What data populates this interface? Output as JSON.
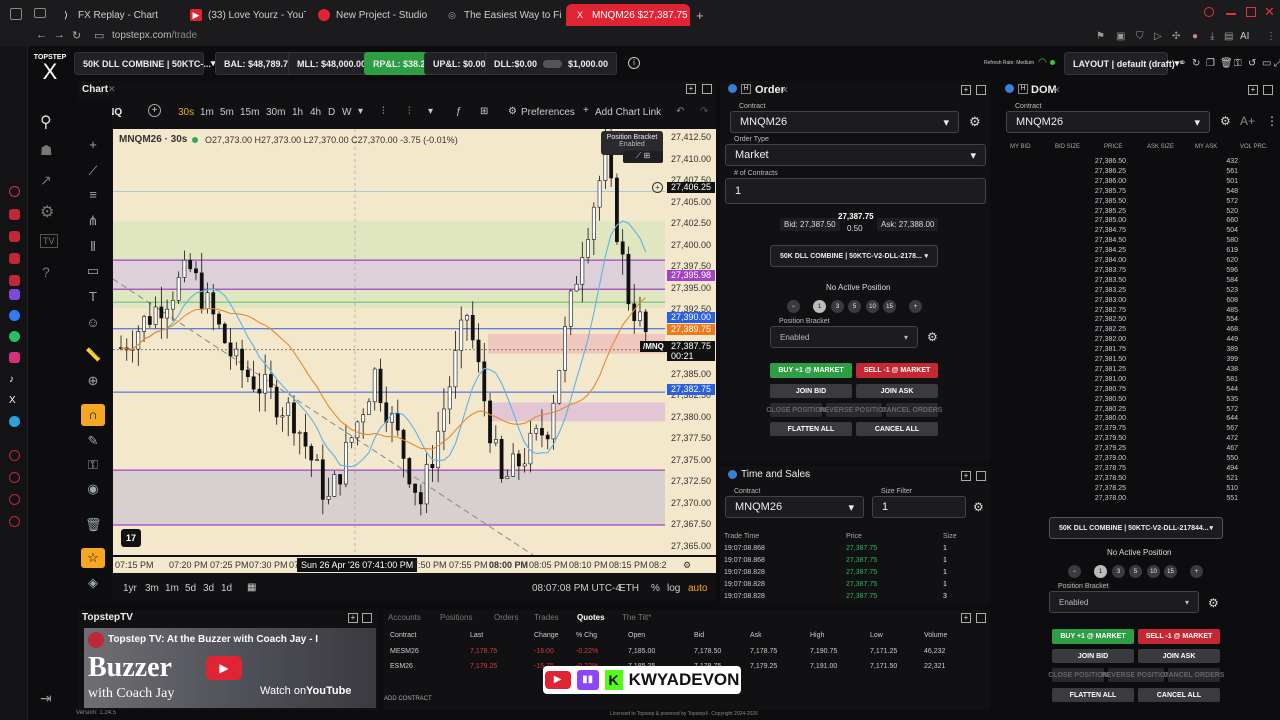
{
  "browser": {
    "tabs": [
      {
        "label": "FX Replay - Chart",
        "active": false
      },
      {
        "label": "(33) Love Yourz - YouTub",
        "active": false
      },
      {
        "label": "New Project - Studio",
        "active": false
      },
      {
        "label": "The Easiest Way to Find F",
        "active": false
      },
      {
        "label": "MNQM26 $27,387.75 ▼ -",
        "active": true
      }
    ],
    "new_tab": "+",
    "url_host": "topstepx.com",
    "url_path": "/trade",
    "toolbar_ai": "AI"
  },
  "app": {
    "logo_top": "TOPSTEP",
    "logo_mark": "X",
    "version": "Version: 1.24.5",
    "footer": "Licensed to Topstep & powered by TopstepX. Copyright 2024-2026",
    "refresh_rate": "Refresh Rate: Medium"
  },
  "topbar": {
    "account": "50K DLL COMBINE  |  50KTC-...",
    "bal": "BAL: $48,789.76",
    "mll": "MLL: $48,000.00",
    "rpl": "RP&L: $38.28",
    "upl": "UP&L: $0.00",
    "dll": "DLL:$0.00",
    "dll_limit": "$1,000.00",
    "layout": "LAYOUT | default (draft)"
  },
  "chart": {
    "panel_title": "Chart",
    "symbol_search": "/MNQ",
    "intervals": [
      "30s",
      "1m",
      "5m",
      "15m",
      "30m",
      "1h",
      "4h",
      "D",
      "W"
    ],
    "active_interval": "30s",
    "preferences": "Preferences",
    "add_chart_link": "Add Chart Link",
    "legend_symbol": "MNQM26 · 30s",
    "legend_ohlc": "O27,373.00  H27,373.00  L27,370.00  C27,370.00  -3.75 (-0.01%)",
    "bracket_tooltip_title": "Position Bracket",
    "bracket_tooltip_value": "Enabled",
    "price_labels": [
      "27,412.50",
      "27,410.00",
      "27,407.50",
      "27,405.00",
      "27,402.50",
      "27,400.00",
      "27,397.50",
      "27,395.00",
      "27,392.50",
      "27,390.00",
      "27,387.50",
      "27,385.00",
      "27,382.50",
      "27,380.00",
      "27,377.50",
      "27,375.00",
      "27,372.50",
      "27,370.00",
      "27,367.50",
      "27,365.00"
    ],
    "marker_labels": {
      "cross": "27,406.25",
      "purple": "27,395.98",
      "blue1": "27,390.00",
      "orange": "27,389.75",
      "current": "27,387.75",
      "countdown": "00:21",
      "blue2": "27,382.75",
      "symbol_tag": "/MNQ"
    },
    "time_labels": [
      "07:15 PM",
      "07:20 PM",
      "07:25 PM",
      "07:30 PM",
      "07:3",
      "7:50 PM",
      "07:55 PM",
      "08:00 PM",
      "08:05 PM",
      "08:10 PM",
      "08:15 PM",
      "08:2"
    ],
    "crosshair_time": "Sun 26 Apr '26   07:41:00 PM",
    "ranges": [
      "1yr",
      "3m",
      "1m",
      "5d",
      "3d",
      "1d"
    ],
    "clock": "08:07:08 PM UTC-4",
    "session": "ETH",
    "pct": "%",
    "log": "log",
    "auto": "auto"
  },
  "order": {
    "title": "Order",
    "contract_label": "Contract",
    "contract": "MNQM26",
    "order_type_label": "Order Type",
    "order_type": "Market",
    "qty_label": "# of Contracts",
    "qty": "1",
    "bid": "Bid: 27,387.50",
    "last": "27,387.75",
    "spread": "0.50",
    "ask": "Ask: 27,388.00",
    "account": "50K DLL COMBINE  |  50KTC-V2-DLL-2178...",
    "position": "No Active Position",
    "quick_qty": [
      "−",
      "1",
      "3",
      "5",
      "10",
      "15",
      "+"
    ],
    "bracket_label": "Position Bracket",
    "bracket": "Enabled",
    "buy": "BUY +1 @ MARKET",
    "sell": "SELL -1 @ MARKET",
    "join_bid": "JOIN BID",
    "join_ask": "JOIN ASK",
    "close_position": "CLOSE POSITION",
    "reverse_position": "REVERSE POSITION",
    "cancel_orders": "CANCEL ORDERS",
    "flatten_all": "FLATTEN ALL",
    "cancel_all": "CANCEL ALL"
  },
  "time_sales": {
    "title": "Time and Sales",
    "contract_label": "Contract",
    "contract": "MNQM26",
    "size_filter_label": "Size Filter",
    "size_filter": "1",
    "headers": [
      "Trade Time",
      "Price",
      "Size"
    ],
    "rows": [
      [
        "19:07:08.868",
        "27,387.75",
        "1"
      ],
      [
        "19:07:08.868",
        "27,387.75",
        "1"
      ],
      [
        "19:07:08.828",
        "27,387.75",
        "1"
      ],
      [
        "19:07:08.828",
        "27,387.75",
        "1"
      ],
      [
        "19:07:08.828",
        "27,387.75",
        "3"
      ]
    ]
  },
  "dom": {
    "title": "DOM",
    "contract_label": "Contract",
    "contract": "MNQM26",
    "headers": [
      "MY BID",
      "BID SIZE",
      "PRICE",
      "ASK SIZE",
      "MY ASK",
      "VOL PRC."
    ],
    "rows": [
      [
        "27,386.50",
        "432"
      ],
      [
        "27,386.25",
        "561"
      ],
      [
        "27,386.00",
        "501"
      ],
      [
        "27,385.75",
        "548"
      ],
      [
        "27,385.50",
        "572"
      ],
      [
        "27,385.25",
        "520"
      ],
      [
        "27,385.00",
        "660"
      ],
      [
        "27,384.75",
        "504"
      ],
      [
        "27,384.50",
        "580"
      ],
      [
        "27,384.25",
        "619"
      ],
      [
        "27,384.00",
        "620"
      ],
      [
        "27,383.75",
        "596"
      ],
      [
        "27,383.50",
        "584"
      ],
      [
        "27,383.25",
        "523"
      ],
      [
        "27,383.00",
        "608"
      ],
      [
        "27,382.75",
        "485"
      ],
      [
        "27,382.50",
        "554"
      ],
      [
        "27,382.25",
        "468"
      ],
      [
        "27,382.00",
        "449"
      ],
      [
        "27,381.75",
        "389"
      ],
      [
        "27,381.50",
        "399"
      ],
      [
        "27,381.25",
        "438"
      ],
      [
        "27,381.00",
        "581"
      ],
      [
        "27,380.75",
        "544"
      ],
      [
        "27,380.50",
        "535"
      ],
      [
        "27,380.25",
        "572"
      ],
      [
        "27,380.00",
        "644"
      ],
      [
        "27,379.75",
        "567"
      ],
      [
        "27,379.50",
        "472"
      ],
      [
        "27,379.25",
        "467"
      ],
      [
        "27,379.00",
        "550"
      ],
      [
        "27,378.75",
        "494"
      ],
      [
        "27,378.50",
        "521"
      ],
      [
        "27,378.25",
        "510"
      ],
      [
        "27,378.00",
        "551"
      ]
    ],
    "account": "50K DLL COMBINE  |  50KTC-V2-DLL-217844...",
    "position": "No Active Position",
    "bracket_label": "Position Bracket",
    "bracket": "Enabled",
    "buy": "BUY +1 @ MARKET",
    "sell": "SELL -1 @ MARKET",
    "join_bid": "JOIN BID",
    "join_ask": "JOIN ASK",
    "close_position": "CLOSE POSITION",
    "reverse_position": "REVERSE POSITION",
    "cancel_orders": "CANCEL ORDERS",
    "flatten_all": "FLATTEN ALL",
    "cancel_all": "CANCEL ALL"
  },
  "bottom": {
    "tabs": [
      "Accounts",
      "Positions",
      "Orders",
      "Trades",
      "Quotes",
      "The Tilt*"
    ],
    "active_tab": "Quotes",
    "headers": [
      "Contract",
      "Last",
      "Change",
      "% Chg",
      "Open",
      "Bid",
      "Ask",
      "High",
      "Low",
      "Volume"
    ],
    "rows": [
      [
        "MESM26",
        "7,178.75",
        "-16.00",
        "-0.22%",
        "7,185.00",
        "7,178.50",
        "7,178.75",
        "7,190.75",
        "7,171.25",
        "46,232"
      ],
      [
        "ESM26",
        "7,179.25",
        "-15.75",
        "-0.22%",
        "7,185.25",
        "7,178.75",
        "7,179.25",
        "7,191.00",
        "7,171.50",
        "22,321"
      ]
    ],
    "add_contract": "ADD CONTRACT"
  },
  "topstep_tv": {
    "title": "TopstepTV",
    "video_title": "Topstep TV: At the Buzzer with Coach Jay - I",
    "overlay_big": "Buzzer",
    "overlay_small": "with Coach Jay",
    "watch_on": "Watch on",
    "youtube": "YouTube"
  },
  "streamer_tag": "KWYADEVON"
}
